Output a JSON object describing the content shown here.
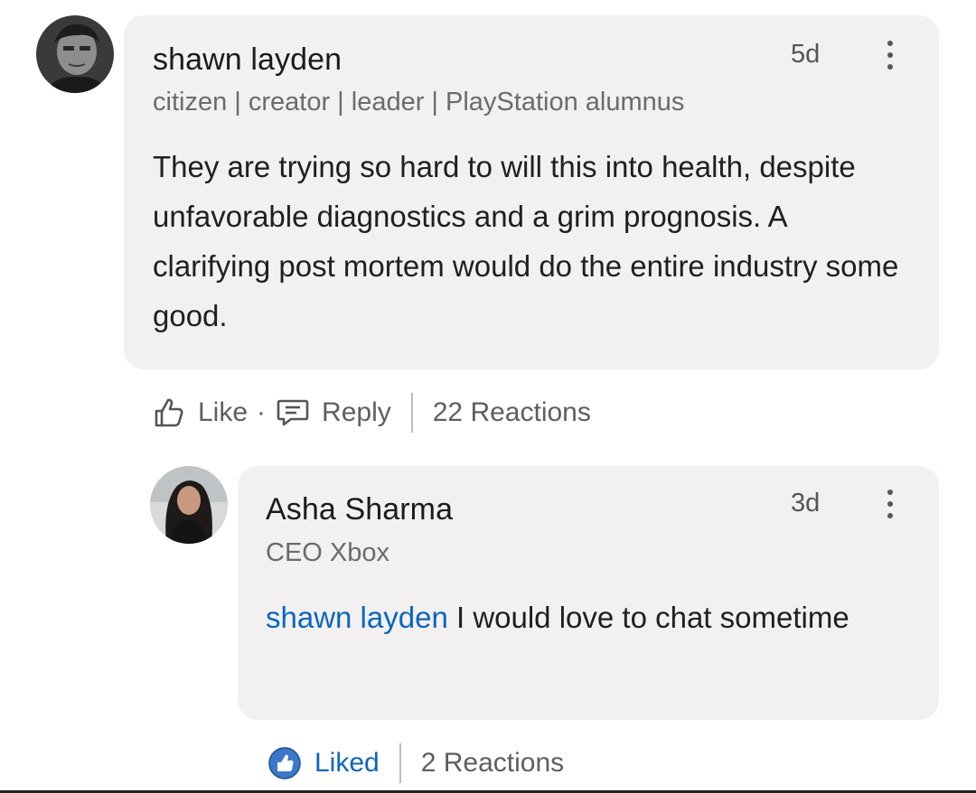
{
  "comment": {
    "author": "shawn layden",
    "headline": "citizen | creator | leader | PlayStation alumnus",
    "time": "5d",
    "text": "They are trying so hard to will this into health, despite unfavorable diagnostics and a grim prognosis. A clarifying post mortem would do the entire industry some good.",
    "like_label": "Like",
    "separator": "·",
    "reply_label": "Reply",
    "reactions": "22 Reactions"
  },
  "reply": {
    "author": "Asha Sharma",
    "headline": "CEO Xbox",
    "time": "3d",
    "mention": "shawn layden",
    "text": " I would love to chat sometime",
    "liked_label": "Liked",
    "reactions": "2 Reactions"
  },
  "colors": {
    "bubble": "#f2f1ef",
    "link": "#0a66c2",
    "muted": "#6b6b6b"
  },
  "icons": {
    "like": "thumbs-up-outline-icon",
    "reply": "speech-bubble-icon",
    "liked": "thumbs-up-filled-icon",
    "more": "more-vertical-icon"
  }
}
